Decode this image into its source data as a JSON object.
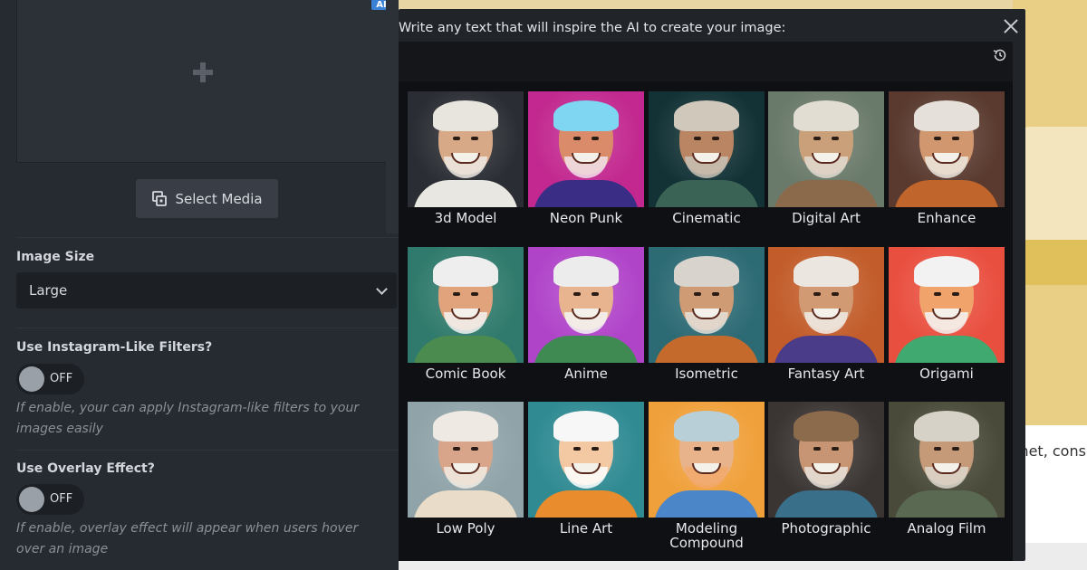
{
  "left_panel": {
    "ai_badge": "AI",
    "plus_icon": "plus-icon",
    "select_media_label": "Select Media",
    "image_size": {
      "title": "Image Size",
      "value": "Large"
    },
    "instagram_filters": {
      "title": "Use Instagram-Like Filters?",
      "toggle": "OFF",
      "hint": "If enable, your can apply Instagram-like filters to your images easily"
    },
    "overlay_effect": {
      "title": "Use Overlay Effect?",
      "toggle": "OFF",
      "hint": "If enable, overlay effect will appear when users hover over an image"
    }
  },
  "background": {
    "partial_text": "met, conse"
  },
  "modal": {
    "prompt_label": "Write any text that will inspire the AI to create your image:",
    "prompt_value": "",
    "styles": [
      {
        "label": "3d Model",
        "bg": "#2a2d33",
        "skin": "#d8a987",
        "hair": "#e8e4de",
        "shirt": "#e9e7e2",
        "beard": "#eeeae4"
      },
      {
        "label": "Neon Punk",
        "bg": "#c2288f",
        "skin": "#d98b6a",
        "hair": "#7fd6f2",
        "shirt": "#3a2d86",
        "beard": "#f1e2ea"
      },
      {
        "label": "Cinematic",
        "bg": "#123235",
        "skin": "#b98563",
        "hair": "#cfc8bb",
        "shirt": "#3a6355",
        "beard": "#c8c2b6"
      },
      {
        "label": "Digital Art",
        "bg": "#6a7a6a",
        "skin": "#caa07b",
        "hair": "#e2ddd2",
        "shirt": "#8a6a4a",
        "beard": "#e0dbd1"
      },
      {
        "label": "Enhance",
        "bg": "#5a3a2f",
        "skin": "#d1986f",
        "hair": "#e5e1da",
        "shirt": "#c0652b",
        "beard": "#ece7df"
      },
      {
        "label": "Comic Book",
        "bg": "#2f7a6c",
        "skin": "#e0a37c",
        "hair": "#eeeeee",
        "shirt": "#4b8b4f",
        "beard": "#f3f3f3"
      },
      {
        "label": "Anime",
        "bg": "#b044c9",
        "skin": "#e8b48f",
        "hair": "#ececec",
        "shirt": "#3f8a52",
        "beard": "#f4f4f4"
      },
      {
        "label": "Isometric",
        "bg": "#2c6a74",
        "skin": "#cf9b74",
        "hair": "#d8d4cd",
        "shirt": "#c46a2c",
        "beard": "#e5e1d9"
      },
      {
        "label": "Fantasy Art",
        "bg": "#c25c2a",
        "skin": "#d29a72",
        "hair": "#ebe6e0",
        "shirt": "#4b3c8a",
        "beard": "#f1ede8"
      },
      {
        "label": "Origami",
        "bg": "#e94f3f",
        "skin": "#f1a36c",
        "hair": "#f2f2f2",
        "shirt": "#3fa96f",
        "beard": "#f5f5f5"
      },
      {
        "label": "Low Poly",
        "bg": "#8fa3a8",
        "skin": "#d9a58a",
        "hair": "#eee9e2",
        "shirt": "#e9dcc8",
        "beard": "#f1ece4"
      },
      {
        "label": "Line Art",
        "bg": "#2f8a92",
        "skin": "#f2c9a3",
        "hair": "#f7f7f7",
        "shirt": "#e98c2d",
        "beard": "#ffffff"
      },
      {
        "label": "Modeling Compound",
        "bg": "#f0a03a",
        "skin": "#e8b28a",
        "hair": "#b8cfd8",
        "shirt": "#4a86c8",
        "beard": "#f2a86a"
      },
      {
        "label": "Photographic",
        "bg": "#3a3532",
        "skin": "#c79474",
        "hair": "#8c6a4c",
        "shirt": "#3a6f8a",
        "beard": "#e8e3dc"
      },
      {
        "label": "Analog Film",
        "bg": "#4a4a3a",
        "skin": "#c49a78",
        "hair": "#d7d2c7",
        "shirt": "#5a6a52",
        "beard": "#ddd7cc"
      }
    ]
  }
}
